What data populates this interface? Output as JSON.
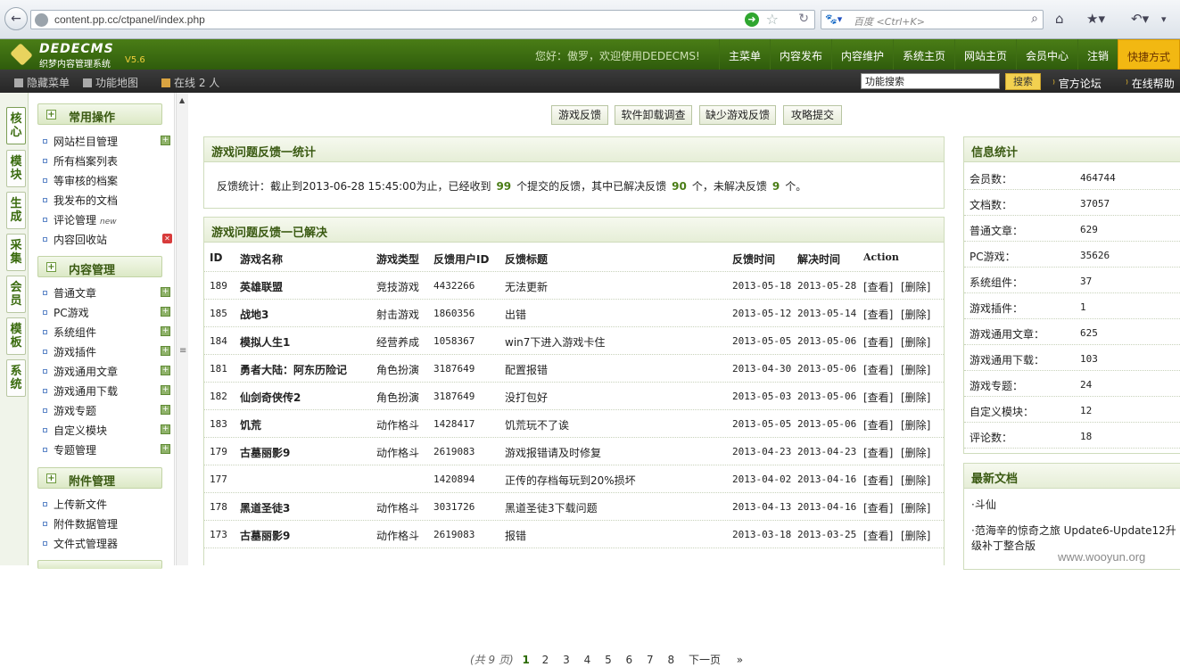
{
  "browser": {
    "url": "content.pp.cc/ctpanel/index.php",
    "search_placeholder": "百度 <Ctrl+K>"
  },
  "header": {
    "logo_title": "DEDECMS",
    "logo_subtitle": "织梦内容管理系统",
    "version": "V5.6",
    "greeting": "您好：傲罗，欢迎使用DEDECMS!",
    "nav": [
      "主菜单",
      "内容发布",
      "内容维护",
      "系统主页",
      "网站主页",
      "会员中心",
      "注销"
    ],
    "quick": "快捷方式"
  },
  "subbar": {
    "hide_menu": "隐藏菜单",
    "site_map": "功能地图",
    "online": "在线 2 人",
    "search_value": "功能搜索",
    "search_btn": "搜索",
    "forum": "官方论坛",
    "help": "在线帮助"
  },
  "vtabs": [
    "核心",
    "模块",
    "生成",
    "采集",
    "会员",
    "模板",
    "系统"
  ],
  "sidebar": {
    "groups": [
      {
        "title": "常用操作",
        "items": [
          "网站栏目管理",
          "所有档案列表",
          "等审核的档案",
          "我发布的文档",
          "评论管理",
          "内容回收站"
        ],
        "new_label": "new"
      },
      {
        "title": "内容管理",
        "items": [
          "普通文章",
          "PC游戏",
          "系统组件",
          "游戏插件",
          "游戏通用文章",
          "游戏通用下载",
          "游戏专题",
          "自定义模块",
          "专题管理"
        ]
      },
      {
        "title": "附件管理",
        "items": [
          "上传新文件",
          "附件数据管理",
          "文件式管理器"
        ]
      }
    ]
  },
  "quick_buttons": [
    "游戏反馈",
    "软件卸载调查",
    "缺少游戏反馈",
    "攻略提交"
  ],
  "stats_panel": {
    "title": "游戏问题反馈一统计",
    "prefix": "反馈统计：截止到2013-06-28 15:45:00为止，已经收到",
    "total": "99",
    "mid": "个提交的反馈，其中已解决反馈",
    "solved": "90",
    "mid2": "个，未解决反馈",
    "unsolved": "9",
    "suffix": "个。"
  },
  "solved_panel": {
    "title": "游戏问题反馈一已解决",
    "columns": [
      "ID",
      "游戏名称",
      "游戏类型",
      "反馈用户ID",
      "反馈标题",
      "反馈时间",
      "解决时间",
      "Action"
    ],
    "rows": [
      [
        "189",
        "英雄联盟",
        "竞技游戏",
        "4432266",
        "无法更新",
        "2013-05-18",
        "2013-05-28"
      ],
      [
        "185",
        "战地3",
        "射击游戏",
        "1860356",
        "出错",
        "2013-05-12",
        "2013-05-14"
      ],
      [
        "184",
        "模拟人生1",
        "经营养成",
        "1058367",
        "win7下进入游戏卡住",
        "2013-05-05",
        "2013-05-06"
      ],
      [
        "181",
        "勇者大陆：阿东历险记",
        "角色扮演",
        "3187649",
        "配置报错",
        "2013-04-30",
        "2013-05-06"
      ],
      [
        "182",
        "仙剑奇侠传2",
        "角色扮演",
        "3187649",
        "没打包好",
        "2013-05-03",
        "2013-05-06"
      ],
      [
        "183",
        "饥荒",
        "动作格斗",
        "1428417",
        "饥荒玩不了诶",
        "2013-05-05",
        "2013-05-06"
      ],
      [
        "179",
        "古墓丽影9",
        "动作格斗",
        "2619083",
        "游戏报错请及时修复",
        "2013-04-23",
        "2013-04-23"
      ],
      [
        "177",
        "",
        "",
        "1420894",
        "正传的存档每玩到20%损坏",
        "2013-04-02",
        "2013-04-16"
      ],
      [
        "178",
        "黑道圣徒3",
        "动作格斗",
        "3031726",
        "黑道圣徒3下载问题",
        "2013-04-13",
        "2013-04-16"
      ],
      [
        "173",
        "古墓丽影9",
        "动作格斗",
        "2619083",
        "报错",
        "2013-03-18",
        "2013-03-25"
      ]
    ],
    "view_label": "[查看]",
    "delete_label": "[删除]",
    "pager": {
      "total": "(共 9 页)",
      "pages": [
        "1",
        "2",
        "3",
        "4",
        "5",
        "6",
        "7",
        "8"
      ],
      "next": "下一页",
      "last": "»"
    }
  },
  "info_panel": {
    "title": "信息统计",
    "rows": [
      [
        "会员数：",
        "464744"
      ],
      [
        "文档数：",
        "37057"
      ],
      [
        "普通文章：",
        "629"
      ],
      [
        "PC游戏：",
        "35626"
      ],
      [
        "系统组件：",
        "37"
      ],
      [
        "游戏插件：",
        "1"
      ],
      [
        "游戏通用文章：",
        "625"
      ],
      [
        "游戏通用下载：",
        "103"
      ],
      [
        "游戏专题：",
        "24"
      ],
      [
        "自定义模块：",
        "12"
      ],
      [
        "评论数：",
        "18"
      ]
    ]
  },
  "latest_panel": {
    "title": "最新文档",
    "docs": [
      "·斗仙",
      "·范海辛的惊奇之旅 Update6-Update12升级补丁整合版"
    ]
  },
  "watermark": "www.wooyun.org"
}
